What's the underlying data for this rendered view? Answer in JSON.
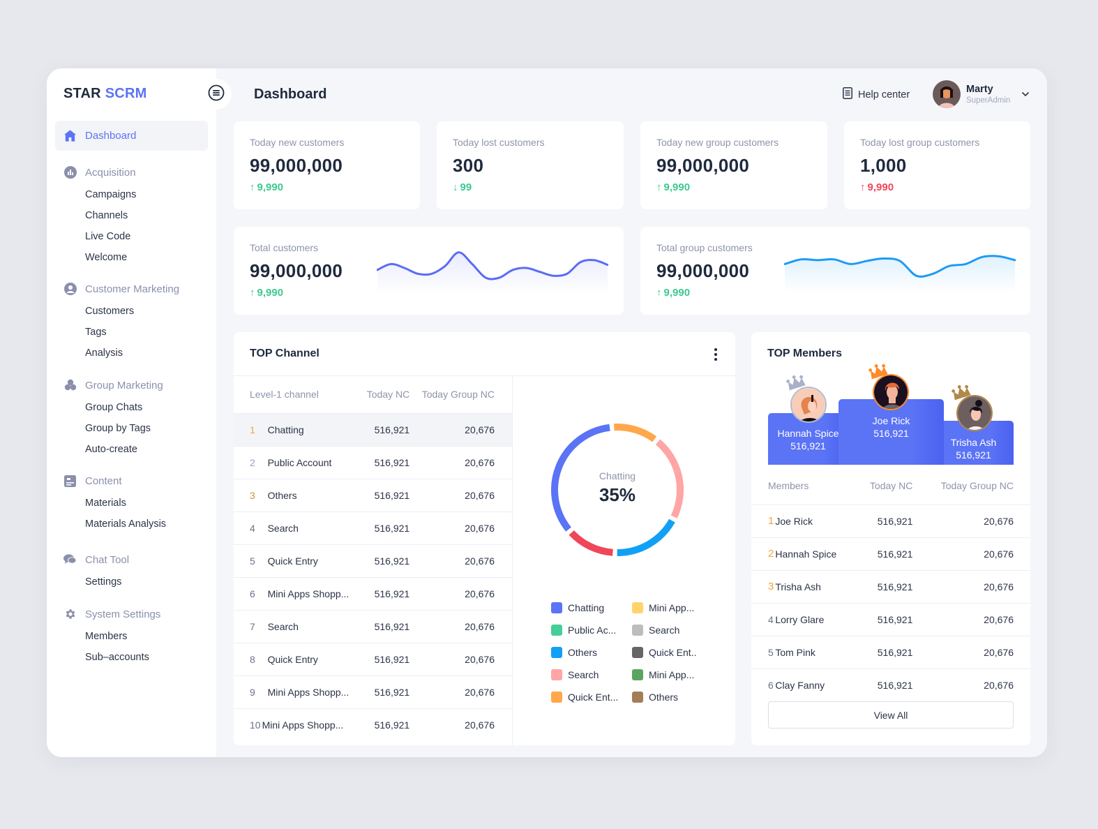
{
  "brand": {
    "part1": "STAR",
    "part2": "SCRM"
  },
  "header": {
    "title": "Dashboard",
    "help": "Help center",
    "user_name": "Marty",
    "user_role": "SuperAdmin"
  },
  "sidebar": {
    "active": {
      "label": "Dashboard",
      "icon": "home-icon"
    },
    "sections": [
      {
        "label": "Acquisition",
        "icon": "chart-icon",
        "items": [
          "Campaigns",
          "Channels",
          "Live Code",
          "Welcome"
        ]
      },
      {
        "label": "Customer Marketing",
        "icon": "user-icon",
        "items": [
          "Customers",
          "Tags",
          "Analysis"
        ]
      },
      {
        "label": "Group Marketing",
        "icon": "group-icon",
        "items": [
          "Group Chats",
          "Group by Tags",
          "Auto-create"
        ]
      },
      {
        "label": "Content",
        "icon": "content-icon",
        "items": [
          "Materials",
          "Materials Analysis"
        ]
      },
      {
        "label": "Chat Tool",
        "icon": "chat-icon",
        "items": [
          "Settings"
        ]
      },
      {
        "label": "System Settings",
        "icon": "gear-icon",
        "items": [
          "Members",
          "Sub–accounts"
        ]
      }
    ]
  },
  "stats": [
    {
      "label": "Today new customers",
      "value": "99,000,000",
      "delta": "9,990",
      "direction": "up",
      "color": "#3ec98f"
    },
    {
      "label": "Today lost customers",
      "value": "300",
      "delta": "99",
      "direction": "down",
      "color": "#3ec98f"
    },
    {
      "label": "Today new group customers",
      "value": "99,000,000",
      "delta": "9,990",
      "direction": "up",
      "color": "#3ec98f"
    },
    {
      "label": "Today lost group customers",
      "value": "1,000",
      "delta": "9,990",
      "direction": "up",
      "color": "#f0465a"
    }
  ],
  "totals": [
    {
      "label": "Total customers",
      "value": "99,000,000",
      "delta": "9,990",
      "direction": "up",
      "line_color": "#5b6cf5",
      "trend": [
        0.45,
        0.6,
        0.5,
        0.35,
        0.35,
        0.55,
        0.9,
        0.6,
        0.25,
        0.25,
        0.45,
        0.5,
        0.4,
        0.3,
        0.35,
        0.65,
        0.7,
        0.58
      ]
    },
    {
      "label": "Total group customers",
      "value": "99,000,000",
      "delta": "9,990",
      "direction": "up",
      "line_color": "#1e9bf5",
      "trend": [
        0.6,
        0.72,
        0.7,
        0.72,
        0.6,
        0.68,
        0.74,
        0.68,
        0.3,
        0.35,
        0.55,
        0.6,
        0.78,
        0.8,
        0.7
      ]
    }
  ],
  "top_channel": {
    "title": "TOP Channel",
    "columns": [
      "Level-1 channel",
      "Today NC",
      "Today Group NC"
    ],
    "rows": [
      {
        "rank": "1",
        "name": "Chatting",
        "nc": "516,921",
        "gnc": "20,676"
      },
      {
        "rank": "2",
        "name": "Public Account",
        "nc": "516,921",
        "gnc": "20,676"
      },
      {
        "rank": "3",
        "name": "Others",
        "nc": "516,921",
        "gnc": "20,676"
      },
      {
        "rank": "4",
        "name": "Search",
        "nc": "516,921",
        "gnc": "20,676"
      },
      {
        "rank": "5",
        "name": "Quick Entry",
        "nc": "516,921",
        "gnc": "20,676"
      },
      {
        "rank": "6",
        "name": "Mini Apps Shopp...",
        "nc": "516,921",
        "gnc": "20,676"
      },
      {
        "rank": "7",
        "name": "Search",
        "nc": "516,921",
        "gnc": "20,676"
      },
      {
        "rank": "8",
        "name": "Quick Entry",
        "nc": "516,921",
        "gnc": "20,676"
      },
      {
        "rank": "9",
        "name": "Mini Apps Shopp...",
        "nc": "516,921",
        "gnc": "20,676"
      },
      {
        "rank": "10",
        "name": "Mini Apps Shopp...",
        "nc": "516,921",
        "gnc": "20,676"
      }
    ],
    "donut": {
      "center_label": "Chatting",
      "center_value": "35%",
      "segments": [
        {
          "name": "Chatting",
          "color": "#5b73f5",
          "value": 35
        },
        {
          "name": "Quick Entry",
          "color": "#ffa74a",
          "value": 12
        },
        {
          "name": "Search",
          "color": "#ffa5a5",
          "value": 22
        },
        {
          "name": "Others",
          "color": "#12a0f5",
          "value": 18
        },
        {
          "name": "Public Account",
          "color": "#f0465a",
          "value": 13
        }
      ]
    },
    "legend": [
      {
        "label": "Chatting",
        "color": "#5b73f5"
      },
      {
        "label": "Mini App...",
        "color": "#ffd46b"
      },
      {
        "label": "Public Ac...",
        "color": "#45cf98"
      },
      {
        "label": "Search",
        "color": "#bdbdbd"
      },
      {
        "label": "Others",
        "color": "#12a0f5"
      },
      {
        "label": "Quick Ent..",
        "color": "#666666"
      },
      {
        "label": "Search",
        "color": "#ffa5a5"
      },
      {
        "label": "Mini App...",
        "color": "#5ba55f"
      },
      {
        "label": "Quick Ent...",
        "color": "#ffa74a"
      },
      {
        "label": "Others",
        "color": "#a47d56"
      }
    ]
  },
  "top_members": {
    "title": "TOP Members",
    "podium": [
      {
        "place": 2,
        "name": "Hannah Spice",
        "value": "516,921",
        "crown_color": "#a9b0c8"
      },
      {
        "place": 1,
        "name": "Joe Rick",
        "value": "516,921",
        "crown_color": "#ff8a2b"
      },
      {
        "place": 3,
        "name": "Trisha Ash",
        "value": "516,921",
        "crown_color": "#b0894a"
      }
    ],
    "columns": [
      "Members",
      "Today NC",
      "Today Group NC"
    ],
    "rows": [
      {
        "rank": "1",
        "name": "Joe Rick",
        "nc": "516,921",
        "gnc": "20,676"
      },
      {
        "rank": "2",
        "name": "Hannah Spice",
        "nc": "516,921",
        "gnc": "20,676"
      },
      {
        "rank": "3",
        "name": "Trisha Ash",
        "nc": "516,921",
        "gnc": "20,676"
      },
      {
        "rank": "4",
        "name": "Lorry Glare",
        "nc": "516,921",
        "gnc": "20,676"
      },
      {
        "rank": "5",
        "name": "Tom Pink",
        "nc": "516,921",
        "gnc": "20,676"
      },
      {
        "rank": "6",
        "name": "Clay Fanny",
        "nc": "516,921",
        "gnc": "20,676"
      }
    ],
    "view_all": "View All"
  }
}
